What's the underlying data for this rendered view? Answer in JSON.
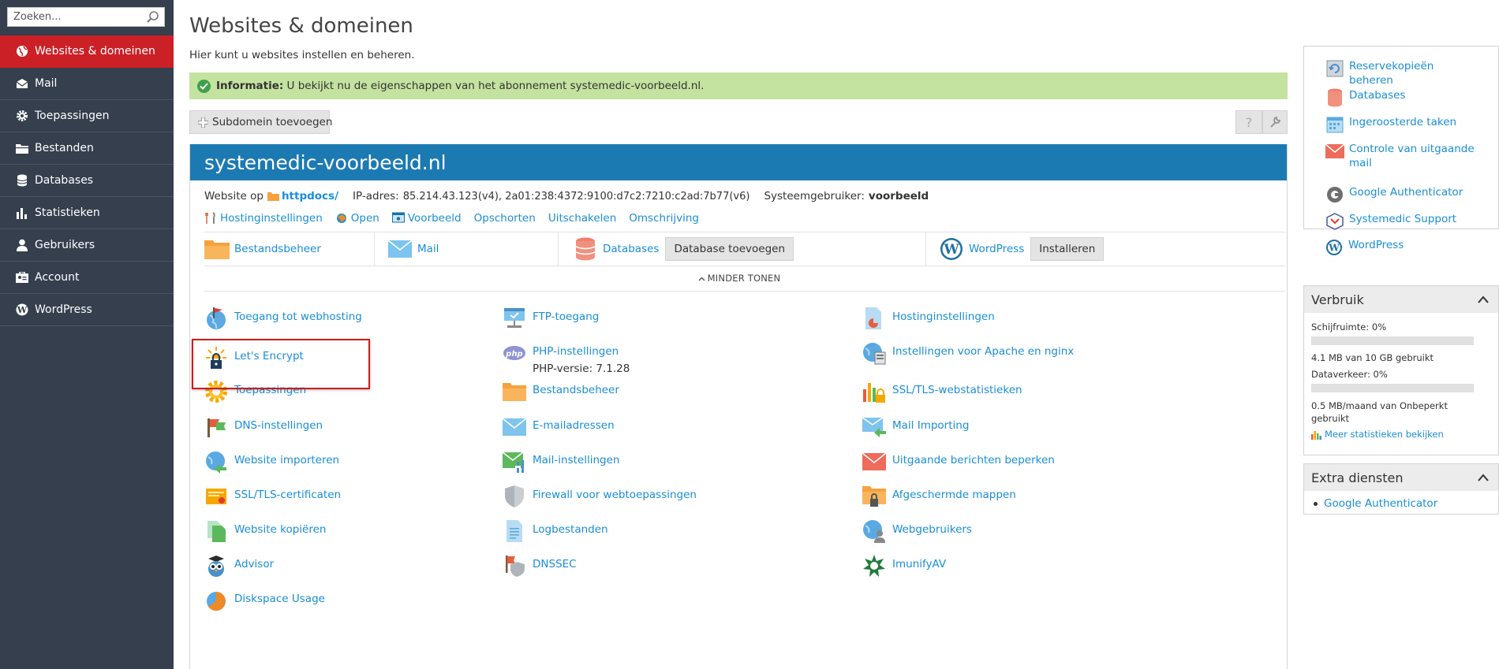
{
  "sidebar": {
    "search_placeholder": "Zoeken...",
    "items": [
      {
        "label": "Websites & domeinen",
        "icon": "globe-icon",
        "active": true
      },
      {
        "label": "Mail",
        "icon": "mail-icon"
      },
      {
        "label": "Toepassingen",
        "icon": "gear-icon"
      },
      {
        "label": "Bestanden",
        "icon": "folder-icon"
      },
      {
        "label": "Databases",
        "icon": "database-icon"
      },
      {
        "label": "Statistieken",
        "icon": "bar-chart-icon"
      },
      {
        "label": "Gebruikers",
        "icon": "user-icon"
      },
      {
        "label": "Account",
        "icon": "account-icon"
      },
      {
        "label": "WordPress",
        "icon": "wordpress-icon"
      }
    ]
  },
  "header": {
    "title": "Websites & domeinen",
    "description": "Hier kunt u websites instellen en beheren."
  },
  "info": {
    "label": "Informatie:",
    "text": " U bekijkt nu de eigenschappen van het abonnement systemedic-voorbeeld.nl."
  },
  "toolbar": {
    "add_subdomain": "Subdomein toevoegen",
    "help_label": "?"
  },
  "domain": {
    "name": "systemedic-voorbeeld.nl",
    "website_prefix": "Website op",
    "docroot": "httpdocs/",
    "ip_label": "IP-adres:",
    "ip_value": "85.214.43.123(v4), 2a01:238:4372:9100:d7c2:7210:c2ad:7b77(v6)",
    "sysuser_label": "Systeemgebruiker:",
    "sysuser_value": "voorbeeld",
    "actions": [
      "Hostinginstellingen",
      "Open",
      "Voorbeeld",
      "Opschorten",
      "Uitschakelen",
      "Omschrijving"
    ],
    "quick": {
      "files": "Bestandsbeheer",
      "mail": "Mail",
      "databases": "Databases",
      "add_db": "Database toevoegen",
      "wordpress": "WordPress",
      "install": "Installeren"
    },
    "less_label": "MINDER TONEN",
    "tools": {
      "col1": [
        "Toegang tot webhosting",
        "Let's Encrypt",
        "Toepassingen",
        "DNS-instellingen",
        "Website importeren",
        "SSL/TLS-certificaten",
        "Website kopiëren",
        "Advisor",
        "Diskspace Usage"
      ],
      "col2": [
        "FTP-toegang",
        "PHP-instellingen",
        "Bestandsbeheer",
        "E-mailadressen",
        "Mail-instellingen",
        "Firewall voor webtoepassingen",
        "Logbestanden",
        "DNSSEC"
      ],
      "col3": [
        "Hostinginstellingen",
        "Instellingen voor Apache en nginx",
        "SSL/TLS-webstatistieken",
        "Mail Importing",
        "Uitgaande berichten beperken",
        "Afgeschermde mappen",
        "Webgebruikers",
        "ImunifyAV"
      ],
      "php_version": "PHP-versie: 7.1.28"
    }
  },
  "right": {
    "links": [
      "Reservekopieën beheren",
      "Databases",
      "Ingeroosterde taken",
      "Controle van uitgaande mail",
      "Google Authenticator",
      "Systemedic Support",
      "WordPress"
    ],
    "usage": {
      "title": "Verbruik",
      "disk_label": "Schijfruimte: 0%",
      "disk_percent": 0,
      "disk_detail": "4.1 MB van 10 GB gebruikt",
      "traffic_label": "Dataverkeer: 0%",
      "traffic_percent": 0,
      "traffic_detail": "0.5 MB/maand van Onbeperkt gebruikt",
      "more_stats": "Meer statistieken bekijken"
    },
    "extra": {
      "title": "Extra diensten",
      "items": [
        "Google Authenticator"
      ]
    }
  },
  "colors": {
    "sidebar_bg": "#353f4e",
    "active_red": "#cc2027",
    "domain_blue": "#1c7ab3",
    "link_blue": "#1a8ed6",
    "info_green": "#c4e2a0"
  }
}
